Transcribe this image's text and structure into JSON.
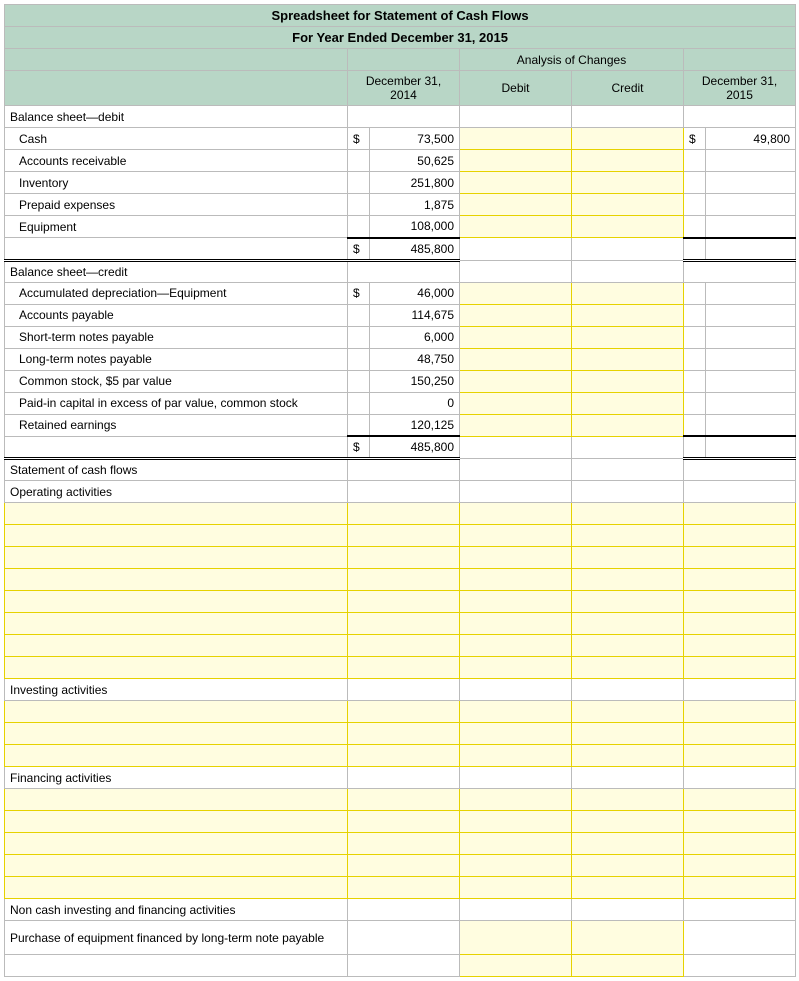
{
  "title1": "Spreadsheet for Statement of Cash Flows",
  "title2": "For Year Ended December 31, 2015",
  "headers": {
    "analysis": "Analysis of Changes",
    "col1": "December 31, 2014",
    "col2": "Debit",
    "col3": "Credit",
    "col4": "December 31, 2015"
  },
  "sections": {
    "bsd": "Balance sheet—debit",
    "bsc": "Balance sheet—credit",
    "scf": "Statement of cash flows",
    "op": "Operating activities",
    "inv": "Investing activities",
    "fin": "Financing activities",
    "nci": "Non cash investing and financing activities",
    "purch": "Purchase of equipment financed by long-term note payable"
  },
  "debit": {
    "cash": {
      "label": "Cash",
      "val": "73,500",
      "val2015": "49,800"
    },
    "ar": {
      "label": "Accounts receivable",
      "val": "50,625"
    },
    "inv": {
      "label": "Inventory",
      "val": "251,800"
    },
    "pre": {
      "label": "Prepaid expenses",
      "val": "1,875"
    },
    "eq": {
      "label": "Equipment",
      "val": "108,000"
    },
    "total": "485,800"
  },
  "credit": {
    "accdep": {
      "label": "Accumulated depreciation—Equipment",
      "val": "46,000"
    },
    "ap": {
      "label": "Accounts payable",
      "val": "114,675"
    },
    "stnp": {
      "label": "Short-term notes payable",
      "val": "6,000"
    },
    "ltnp": {
      "label": "Long-term notes payable",
      "val": "48,750"
    },
    "cs": {
      "label": "Common stock, $5 par value",
      "val": "150,250"
    },
    "pic": {
      "label": "Paid-in capital in excess of par value, common stock",
      "val": "0"
    },
    "re": {
      "label": "Retained earnings",
      "val": "120,125"
    },
    "total": "485,800"
  },
  "sym": "$"
}
